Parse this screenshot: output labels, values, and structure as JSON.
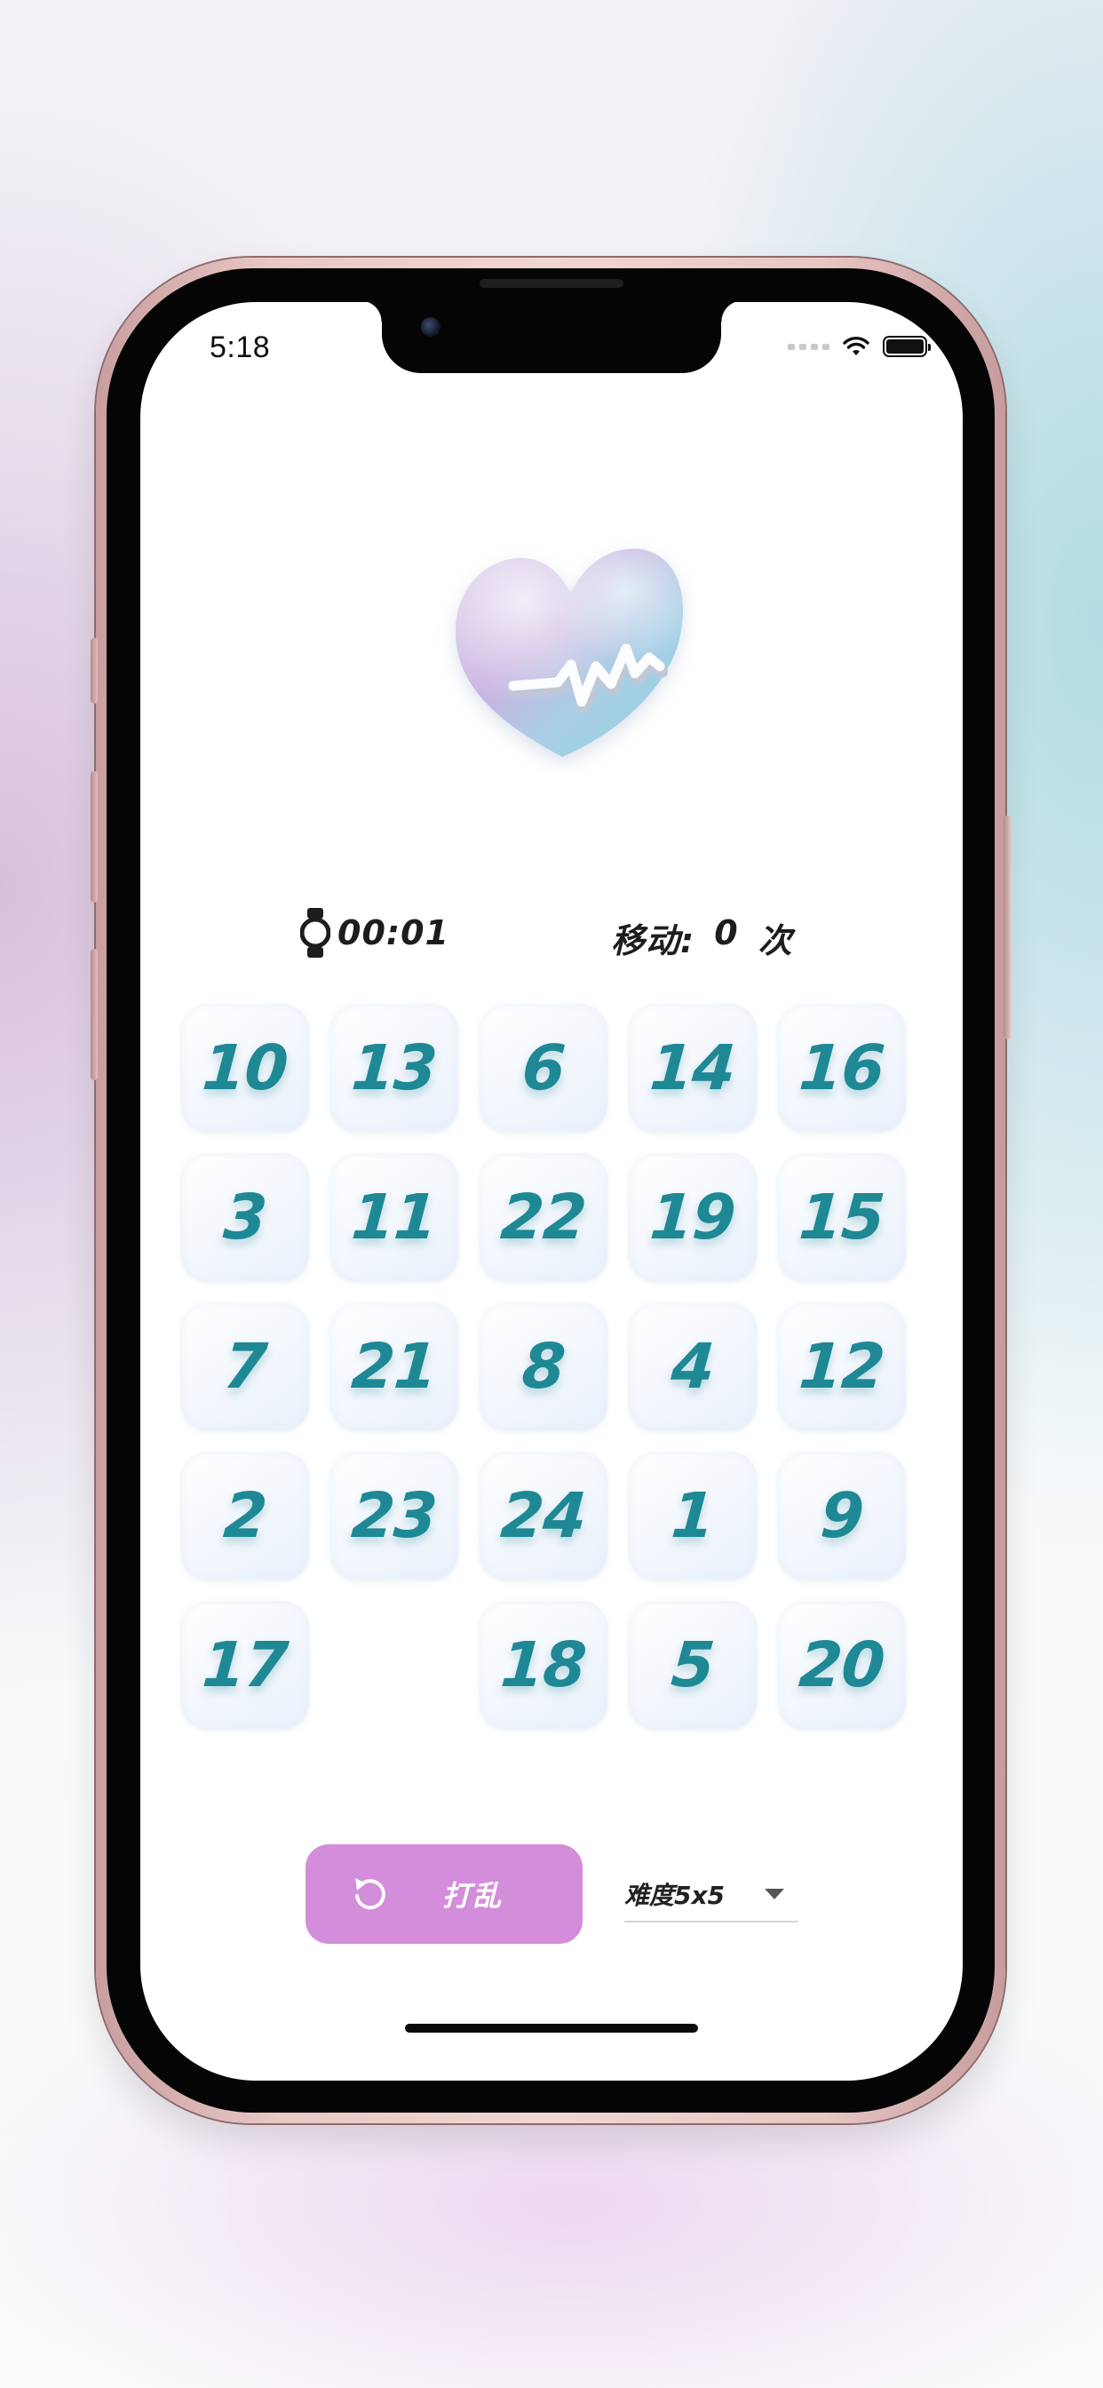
{
  "status_bar": {
    "time": "5:18",
    "wifi_icon": "wifi-icon",
    "battery_icon": "battery-icon"
  },
  "illustration": {
    "icon": "heart-pulse-icon"
  },
  "stats": {
    "timer_icon": "watch-icon",
    "time": "00:01",
    "moves_label": "移动:",
    "moves_count": "0",
    "moves_unit": "次"
  },
  "board": {
    "size": 5,
    "tiles": [
      [
        "10",
        "13",
        "6",
        "14",
        "16"
      ],
      [
        "3",
        "11",
        "22",
        "19",
        "15"
      ],
      [
        "7",
        "21",
        "8",
        "4",
        "12"
      ],
      [
        "2",
        "23",
        "24",
        "1",
        "9"
      ],
      [
        "17",
        "",
        "18",
        "5",
        "20"
      ]
    ]
  },
  "controls": {
    "shuffle_label": "打乱",
    "shuffle_icon": "refresh-icon",
    "difficulty_label": "难度5x5",
    "difficulty_icon": "caret-down-icon"
  },
  "colors": {
    "tile_text": "#1f8895",
    "shuffle_button": "#d48dda"
  }
}
